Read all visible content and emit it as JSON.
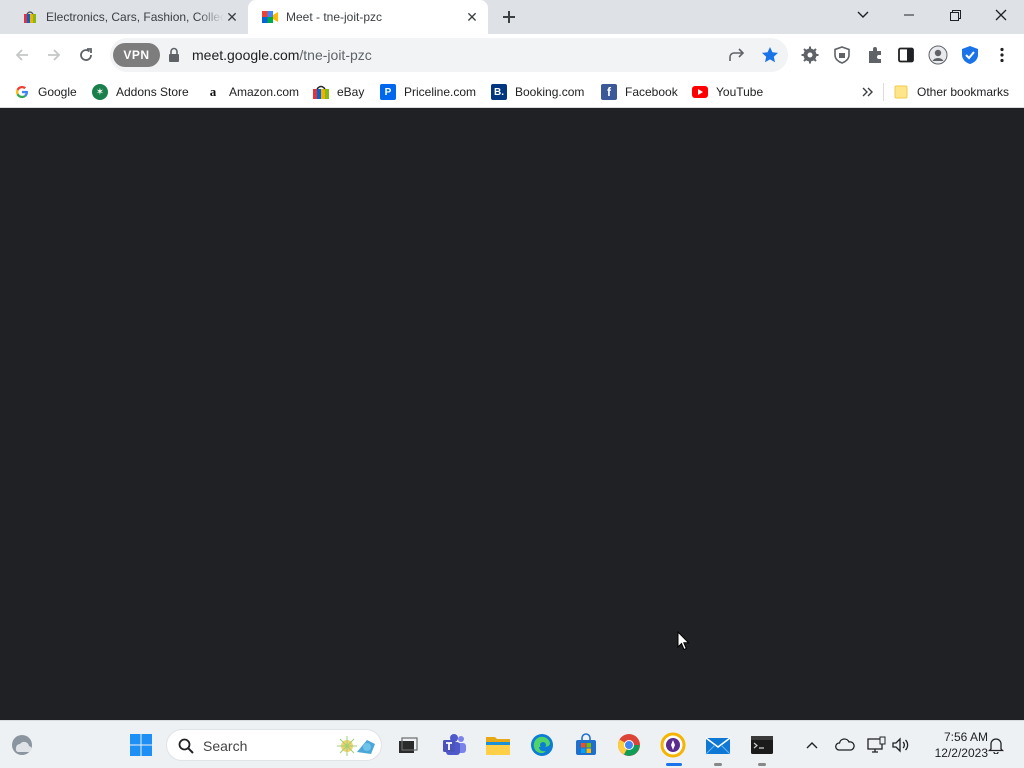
{
  "tabs": [
    {
      "title": "Electronics, Cars, Fashion, Collectibles & More | eBay",
      "active": false,
      "favicon": "ebay-icon"
    },
    {
      "title": "Meet - tne-joit-pzc",
      "active": true,
      "favicon": "google-meet-icon"
    }
  ],
  "window_controls": {
    "minimize": "minimize-icon",
    "restore": "restore-icon",
    "close": "close-icon"
  },
  "omnibox": {
    "vpn_label": "VPN",
    "url_host": "meet.google.com",
    "url_path": "/tne-joit-pzc"
  },
  "bookmarks": [
    {
      "label": "Google",
      "icon": "google-icon"
    },
    {
      "label": "Addons Store",
      "icon": "addons-store-icon"
    },
    {
      "label": "Amazon.com",
      "icon": "amazon-icon"
    },
    {
      "label": "eBay",
      "icon": "ebay-icon"
    },
    {
      "label": "Priceline.com",
      "icon": "priceline-icon"
    },
    {
      "label": "Booking.com",
      "icon": "booking-icon"
    },
    {
      "label": "Facebook",
      "icon": "facebook-icon"
    },
    {
      "label": "YouTube",
      "icon": "youtube-icon"
    }
  ],
  "other_bookmarks": "Other bookmarks",
  "taskbar": {
    "search_label": "Search",
    "time": "7:56 AM",
    "date": "12/2/2023"
  },
  "colors": {
    "content_bg": "#202124",
    "tab_strip": "#dee1e6",
    "accent_blue": "#1a73e8",
    "taskbar_bg": "#eef1f4"
  }
}
